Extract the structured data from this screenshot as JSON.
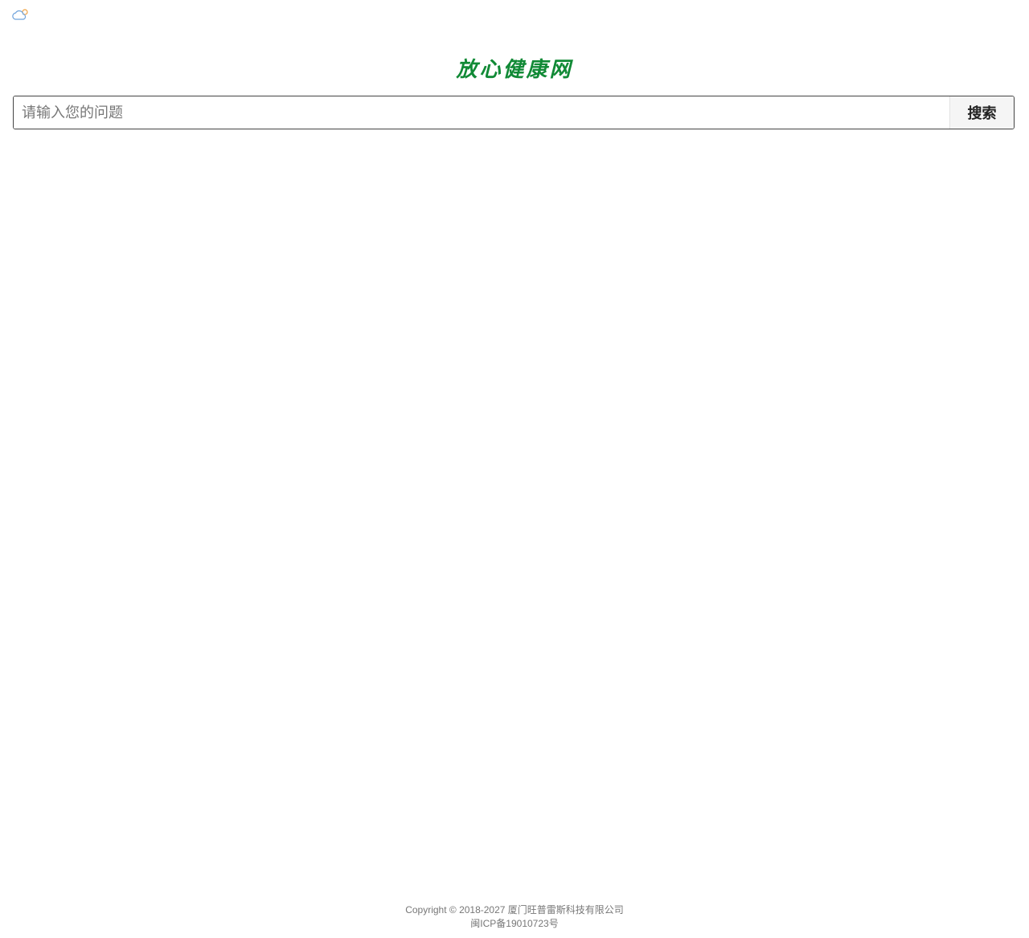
{
  "header": {
    "weather_icon": "partly-cloudy-icon",
    "logo_text": "放心健康网"
  },
  "search": {
    "placeholder": "请输入您的问题",
    "value": "",
    "button_label": "搜索"
  },
  "footer": {
    "copyright": "Copyright © 2018-2027 厦门旺普雷斯科技有限公司",
    "icp": "闽ICP备19010723号"
  },
  "colors": {
    "logo_green": "#118a36",
    "footer_text": "#777777",
    "weather_cloud": "#6fa3dc",
    "weather_sun": "#f0a040"
  }
}
